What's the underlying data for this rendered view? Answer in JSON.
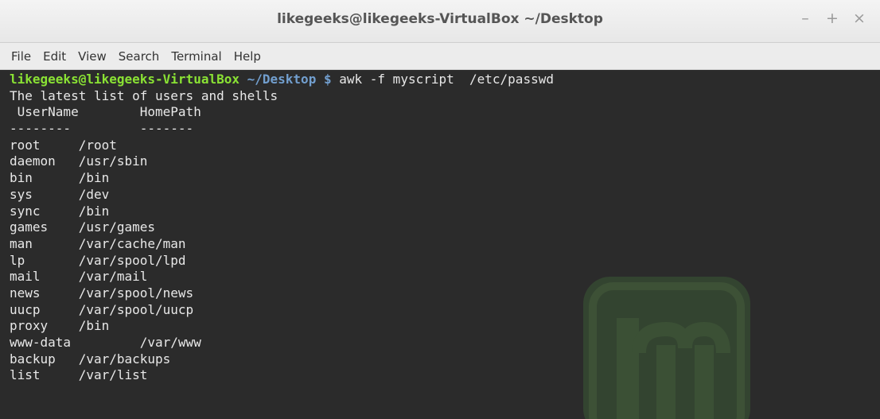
{
  "window": {
    "title": "likegeeks@likegeeks-VirtualBox ~/Desktop"
  },
  "controls": {
    "minimize": "–",
    "maximize": "+",
    "close": "×"
  },
  "menu": [
    "File",
    "Edit",
    "View",
    "Search",
    "Terminal",
    "Help"
  ],
  "prompt": {
    "user_host": "likegeeks@likegeeks-VirtualBox",
    "path": "~/Desktop",
    "dollar": "$",
    "command": "awk -f myscript  /etc/passwd"
  },
  "output": [
    "The latest list of users and shells",
    " UserName        HomePath",
    "--------         -------",
    "root     /root",
    "daemon   /usr/sbin",
    "bin      /bin",
    "sys      /dev",
    "sync     /bin",
    "games    /usr/games",
    "man      /var/cache/man",
    "lp       /var/spool/lpd",
    "mail     /var/mail",
    "news     /var/spool/news",
    "uucp     /var/spool/uucp",
    "proxy    /bin",
    "www-data         /var/www",
    "backup   /var/backups",
    "list     /var/list"
  ],
  "colors": {
    "user": "#8ae234",
    "path": "#729fcf",
    "text": "#e8e8e8",
    "background": "#2b2b2b",
    "watermark": "#3a4a32"
  },
  "icons": {
    "watermark": "linux-mint-logo-icon"
  }
}
